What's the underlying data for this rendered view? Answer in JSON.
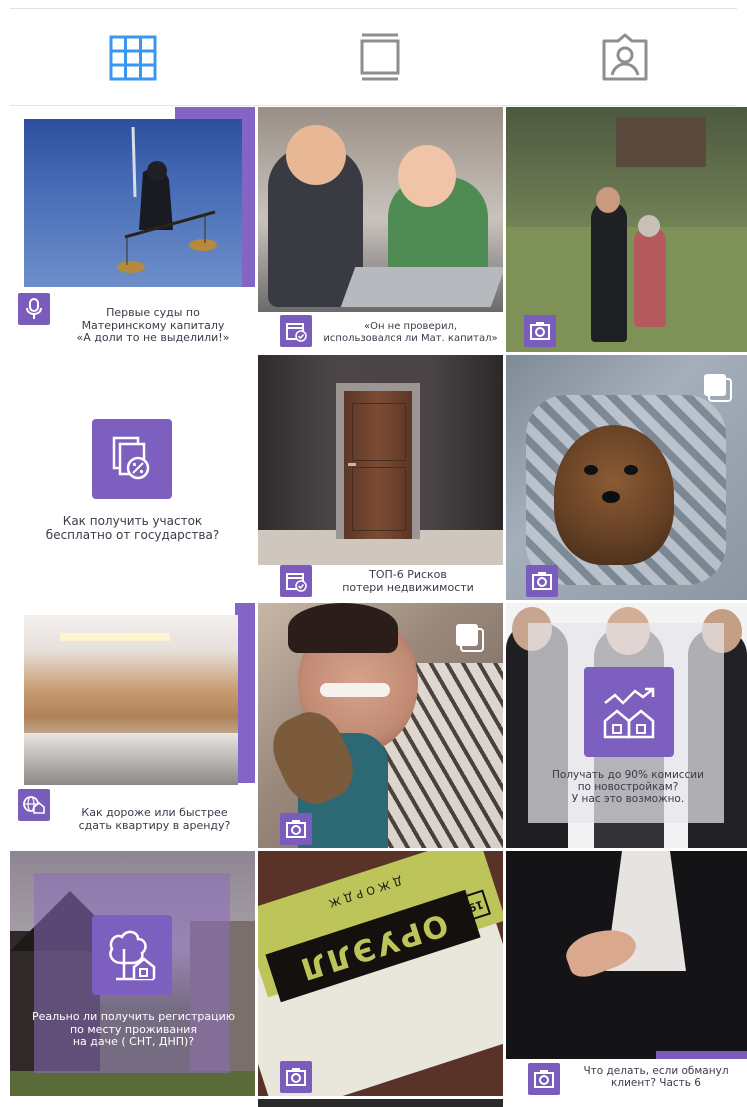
{
  "colors": {
    "accent": "#3897f0",
    "inactive": "#8e8e8e",
    "brand_purple": "#7a5cbc"
  },
  "tabs": [
    {
      "name": "grid-view",
      "icon": "grid-icon",
      "active": true
    },
    {
      "name": "feed-view",
      "icon": "feed-icon",
      "active": false
    },
    {
      "name": "tagged",
      "icon": "tagged-person-icon",
      "active": false
    }
  ],
  "posts": [
    {
      "caption": "Первые суды по\nМатеринскому капиталу\n«А доли то не выделили!»",
      "badge": "microphone-icon"
    },
    {
      "caption": "«Он не проверил,\nиспользовался ли Мат. капитал»",
      "badge": "calendar-check-icon"
    },
    {
      "caption": "",
      "badge": "camera-icon"
    },
    {
      "caption": "Как получить участок\nбесплатно от государства?",
      "badge": "document-percent-icon"
    },
    {
      "caption": "ТОП-6 Рисков\nпотери недвижимости",
      "badge": "calendar-check-icon"
    },
    {
      "caption": "",
      "badge": "camera-icon",
      "multiple": true
    },
    {
      "caption": "Как дороже или быстрее\nсдать квартиру в аренду?",
      "badge": "globe-house-icon"
    },
    {
      "caption": "",
      "badge": "camera-icon",
      "multiple": true
    },
    {
      "caption": "Получать до 90% комиссии\nпо новостройкам?\nУ нас это возможно.",
      "badge": "houses-growth-icon"
    },
    {
      "caption": "Реально ли получить регистрацию\nпо месту проживания\nна даче ( СНТ, ДНП)?",
      "badge": "tree-house-icon"
    },
    {
      "caption": "",
      "badge": "camera-icon",
      "book_text": "ОРУЭЛЛ",
      "book_author": "ДЖОРДЖ",
      "book_number": "1984"
    },
    {
      "caption": "Что делать, если обманул\nклиент?  Часть 6",
      "badge": "camera-icon"
    }
  ]
}
